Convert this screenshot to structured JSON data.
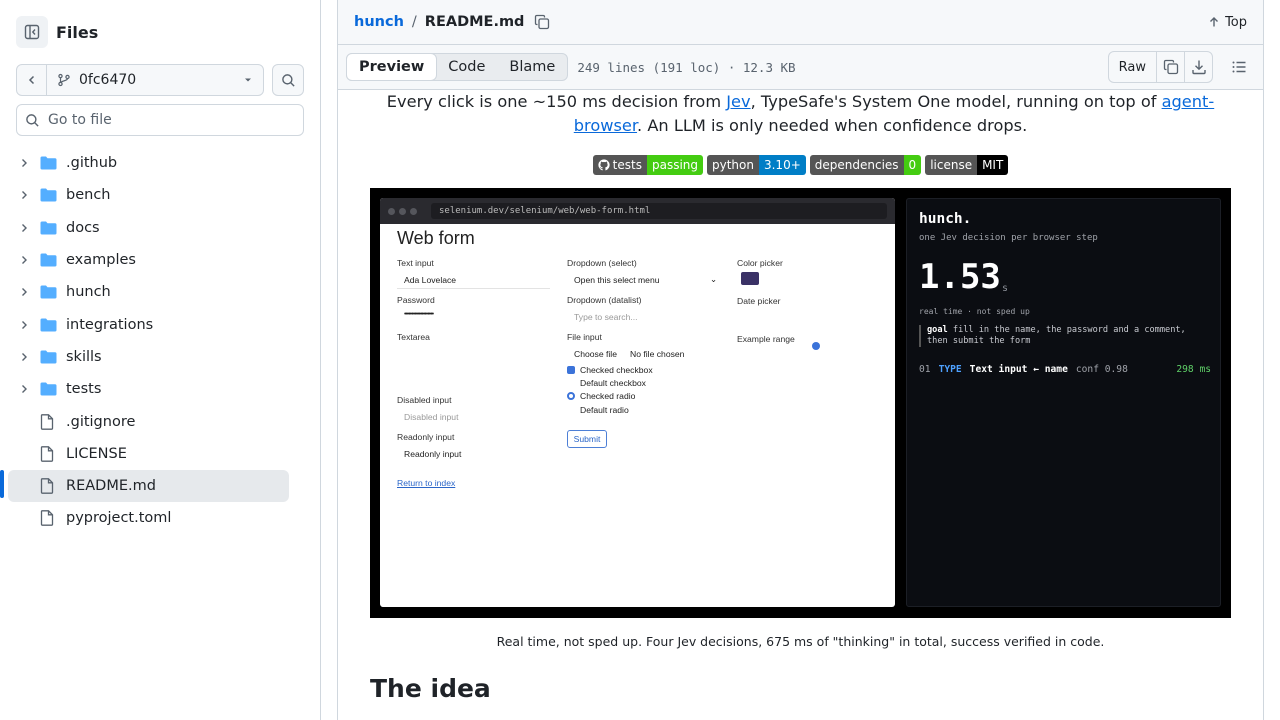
{
  "sidebar": {
    "title": "Files",
    "branch": "0fc6470",
    "goto_placeholder": "Go to file",
    "items": [
      {
        "type": "dir",
        "label": ".github"
      },
      {
        "type": "dir",
        "label": "bench"
      },
      {
        "type": "dir",
        "label": "docs"
      },
      {
        "type": "dir",
        "label": "examples"
      },
      {
        "type": "dir",
        "label": "hunch"
      },
      {
        "type": "dir",
        "label": "integrations"
      },
      {
        "type": "dir",
        "label": "skills"
      },
      {
        "type": "dir",
        "label": "tests"
      },
      {
        "type": "file",
        "label": ".gitignore"
      },
      {
        "type": "file",
        "label": "LICENSE"
      },
      {
        "type": "file",
        "label": "README.md",
        "active": true
      },
      {
        "type": "file",
        "label": "pyproject.toml"
      }
    ]
  },
  "header": {
    "repo": "hunch",
    "separator": "/",
    "file": "README.md",
    "top_label": "Top"
  },
  "toolbar": {
    "tabs": [
      "Preview",
      "Code",
      "Blame"
    ],
    "active_tab": "Preview",
    "file_info": "249 lines (191 loc) · 12.3 KB",
    "raw_label": "Raw"
  },
  "readme": {
    "intro_1": "Every click is one ~150 ms decision from ",
    "intro_link1": "Jev",
    "intro_2": ", TypeSafe's System One model, running on top of ",
    "intro_link2": "agent-browser",
    "intro_3": ". An LLM is only needed when confidence drops.",
    "badges": [
      {
        "label": "tests",
        "value": "passing",
        "color": "#4c1",
        "icon": "github-icon"
      },
      {
        "label": "python",
        "value": "3.10+",
        "color": "#007ec6"
      },
      {
        "label": "dependencies",
        "value": "0",
        "color": "#4c1"
      },
      {
        "label": "license",
        "value": "MIT",
        "color": "#000000"
      }
    ],
    "caption": "Real time, not sped up. Four Jev decisions, 675 ms of \"thinking\" in total, success verified in code.",
    "heading": "The idea"
  },
  "demo": {
    "url": "selenium.dev/selenium/web/web-form.html",
    "form": {
      "title": "Web form",
      "text_input_label": "Text input",
      "text_input_value": "Ada Lovelace",
      "password_label": "Password",
      "password_value": "••••••••••••••••••••",
      "textarea_label": "Textarea",
      "disabled_label": "Disabled input",
      "disabled_placeholder": "Disabled input",
      "readonly_label": "Readonly input",
      "readonly_value": "Readonly input",
      "return_link": "Return to index",
      "dropdown_select_label": "Dropdown (select)",
      "dropdown_select_value": "Open this select menu",
      "dropdown_datalist_label": "Dropdown (datalist)",
      "dropdown_datalist_placeholder": "Type to search...",
      "file_input_label": "File input",
      "choose_file": "Choose file",
      "no_file": "No file chosen",
      "checked_checkbox": "Checked checkbox",
      "default_checkbox": "Default checkbox",
      "checked_radio": "Checked radio",
      "default_radio": "Default radio",
      "submit": "Submit",
      "color_picker_label": "Color picker",
      "color_value": "#3a3166",
      "date_picker_label": "Date picker",
      "range_label": "Example range"
    },
    "panel": {
      "brand": "hunch.",
      "subtitle": "one Jev decision per browser step",
      "time": "1.53",
      "unit": "s",
      "note": "real time · not sped up",
      "goal_label": "goal",
      "goal_text": "fill in the name, the password and a comment, then submit the form",
      "step_num": "01",
      "step_type": "TYPE",
      "step_field": "Text input ← name",
      "step_conf": "conf 0.98",
      "step_ms": "298 ms"
    }
  }
}
